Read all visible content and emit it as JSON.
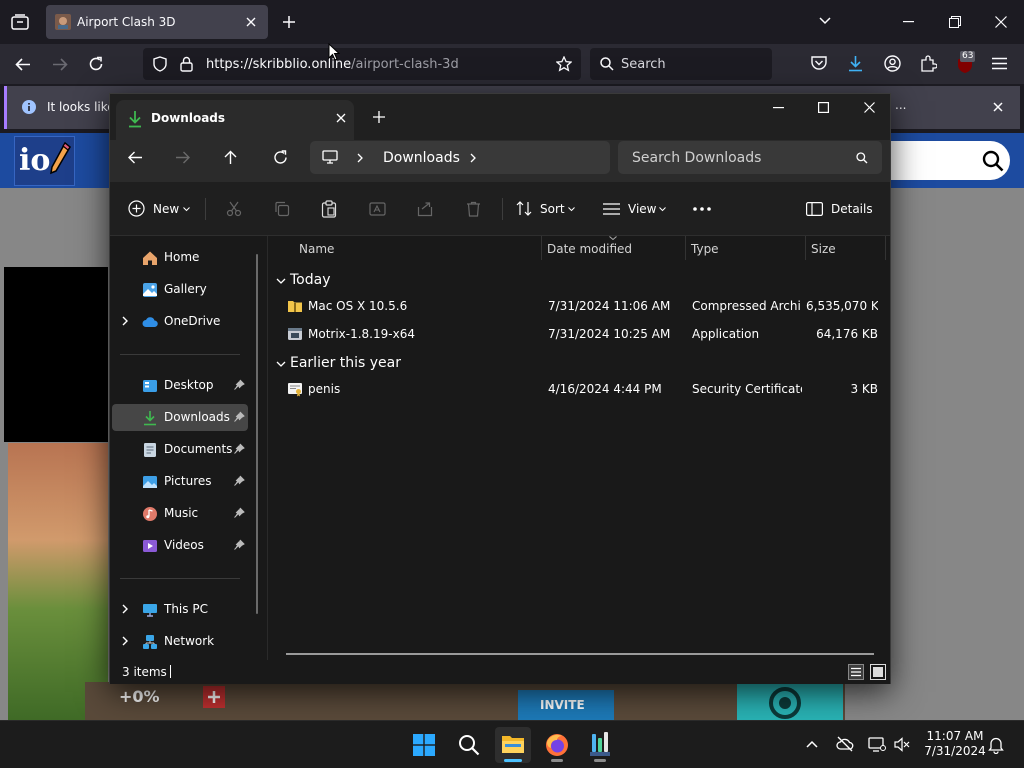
{
  "browser": {
    "tab_title": "Airport Clash 3D",
    "url_host": "https://skribblio.online",
    "url_path": "/airport-clash-3d",
    "search_placeholder": "Search",
    "extension_badge": "63",
    "notification_text": "It looks like",
    "notification_ellipsis": "..."
  },
  "website": {
    "logo_text": "io",
    "bottom_percent": "+0%",
    "invite_label": "INVITE"
  },
  "explorer": {
    "tab_title": "Downloads",
    "breadcrumb": "Downloads",
    "search_placeholder": "Search Downloads",
    "toolbar": {
      "new_label": "New",
      "sort_label": "Sort",
      "view_label": "View",
      "details_label": "Details"
    },
    "sidebar": {
      "home": "Home",
      "gallery": "Gallery",
      "onedrive": "OneDrive",
      "desktop": "Desktop",
      "downloads": "Downloads",
      "documents": "Documents",
      "pictures": "Pictures",
      "music": "Music",
      "videos": "Videos",
      "thispc": "This PC",
      "network": "Network"
    },
    "columns": {
      "name": "Name",
      "date": "Date modified",
      "type": "Type",
      "size": "Size"
    },
    "groups": {
      "today": "Today",
      "earlier": "Earlier this year"
    },
    "files": [
      {
        "name": "Mac OS X 10.5.6",
        "date": "7/31/2024 11:06 AM",
        "type": "Compressed Archi...",
        "size": "6,535,070 KB"
      },
      {
        "name": "Motrix-1.8.19-x64",
        "date": "7/31/2024 10:25 AM",
        "type": "Application",
        "size": "64,176 KB"
      },
      {
        "name": "penis",
        "date": "4/16/2024 4:44 PM",
        "type": "Security Certificate",
        "size": "3 KB"
      }
    ],
    "status_count": "3 items"
  },
  "taskbar": {
    "time": "11:07 AM",
    "date": "7/31/2024"
  },
  "colors": {
    "accent": "#4cc2ff",
    "firefox_purple": "#a77cff",
    "downloads_green": "#3fb950"
  }
}
